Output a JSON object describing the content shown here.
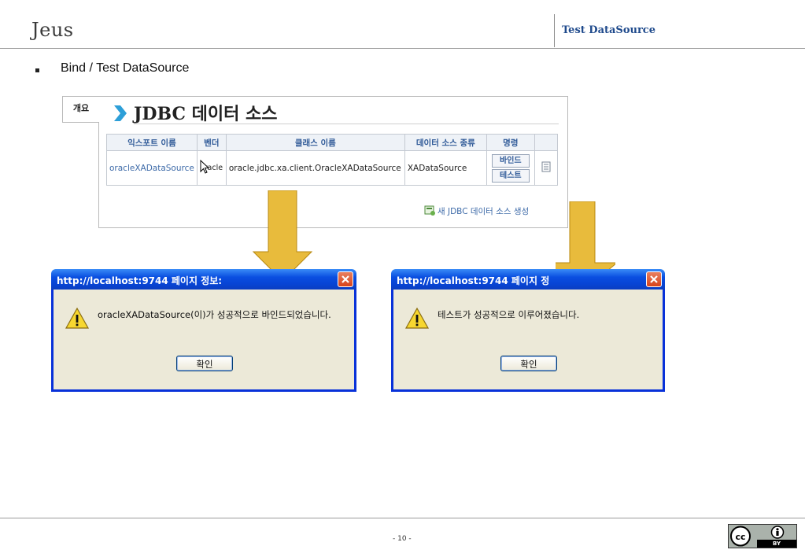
{
  "header": {
    "title": "Jeus",
    "section": "Test DataSource"
  },
  "bullet": "Bind / Test DataSource",
  "console": {
    "tab_label": "개요",
    "heading": "JDBC 데이터 소스",
    "columns": [
      "익스포트 이름",
      "벤더",
      "클래스 이름",
      "데이터 소스 종류",
      "명령",
      ""
    ],
    "row": {
      "export_name": "oracleXADataSource",
      "vendor": "oracle",
      "class_name": "oracle.jdbc.xa.client.OracleXADataSource",
      "ds_type": "XADataSource",
      "bind_label": "바인드",
      "test_label": "테스트"
    },
    "create_link": "새 JDBC 데이터 소스 생성"
  },
  "dialog_bind": {
    "title": "http://localhost:9744 페이지 정보:",
    "message": "oracleXADataSource(이)가 성공적으로 바인드되었습니다.",
    "ok_label": "확인"
  },
  "dialog_test": {
    "title": "http://localhost:9744 페이지 정",
    "message": "테스트가 성공적으로 이루어졌습니다.",
    "ok_label": "확인"
  },
  "footer": {
    "page": "- 10 -",
    "cc_label": "BY"
  },
  "colors": {
    "accent_blue": "#1f4a8c",
    "arrow_gold": "#e8bb3c",
    "xp_title": "#0a4ee0",
    "dialog_bg": "#ece9d8"
  }
}
